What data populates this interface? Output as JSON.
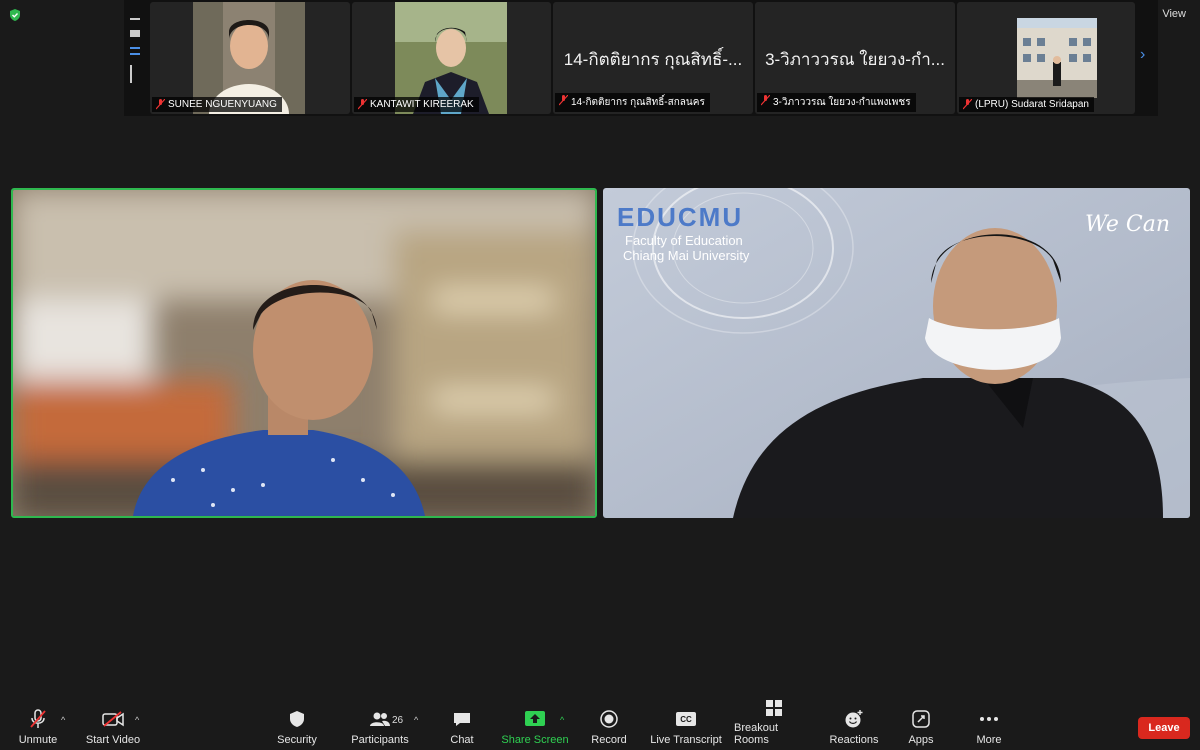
{
  "top": {
    "view_label": "View"
  },
  "participants_strip": [
    {
      "name": "SUNEE NGUENYUANG",
      "has_video": true
    },
    {
      "name": "KANTAWIT KIREERAK",
      "has_video": true
    },
    {
      "name": "14-กิตติยากร กุณสิทธิ์-สกลนคร",
      "display": "14-กิตติยากร กุณสิทธิ์-...",
      "has_video": false
    },
    {
      "name": "3-วิภาววรณ ใยยวง-กำแพงเพชร",
      "display": "3-วิภาววรณ ใยยวง-กำ...",
      "has_video": false
    },
    {
      "name": "(LPRU) Sudarat Sridapan",
      "has_video": true
    }
  ],
  "main_videos": {
    "speaker_right_background": {
      "brand": "EDUCMU",
      "line1": "Faculty of Education",
      "line2": "Chiang Mai University",
      "slogan": "We Can"
    }
  },
  "toolbar": {
    "unmute": "Unmute",
    "start_video": "Start Video",
    "security": "Security",
    "participants": "Participants",
    "participants_count": "26",
    "chat": "Chat",
    "share_screen": "Share Screen",
    "record": "Record",
    "live_transcript": "Live Transcript",
    "breakout_rooms": "Breakout Rooms",
    "reactions": "Reactions",
    "apps": "Apps",
    "more": "More",
    "leave": "Leave"
  },
  "colors": {
    "active_speaker": "#2fb84f",
    "share_green": "#2fd052",
    "leave_red": "#d9281e",
    "accent_blue": "#4a8fe6"
  }
}
